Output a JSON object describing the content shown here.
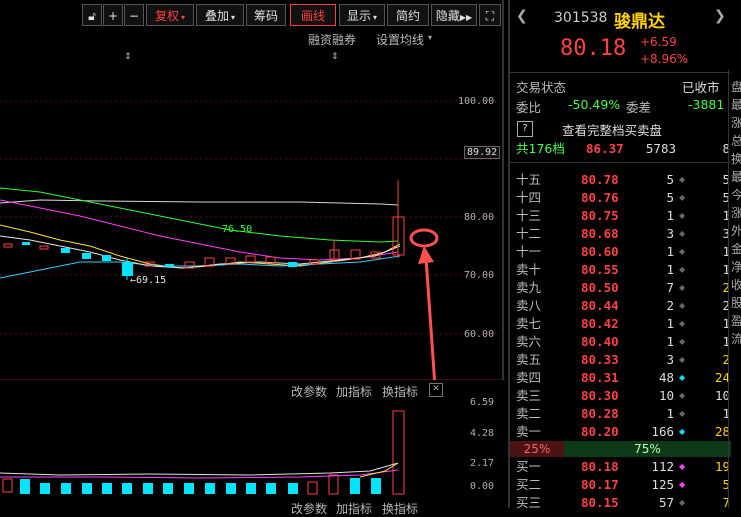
{
  "toolbar": {
    "buttons": [
      "复权",
      "叠加",
      "筹码",
      "画线",
      "显示",
      "简约",
      "隐藏"
    ]
  },
  "chart_top": {
    "links": [
      "融资融券",
      "设置均线"
    ],
    "y_ticks": [
      "100.00",
      "89.92",
      "80.00",
      "70.00",
      "60.00"
    ],
    "ma_label": "76.50",
    "low_label": "←69.15"
  },
  "indicator": {
    "links": [
      "改参数",
      "加指标",
      "换指标"
    ],
    "links_bottom": [
      "改参数",
      "加指标",
      "换指标"
    ],
    "y_ticks": [
      "6.59",
      "4.28",
      "2.17",
      "0.00"
    ]
  },
  "stock": {
    "code": "301538",
    "name": "骏鼎达",
    "price": "80.18",
    "change": "+6.59",
    "change_pct": "+8.96%"
  },
  "status": {
    "label": "交易状态",
    "value": "已收市",
    "ratio_label": "委比",
    "ratio_value": "-50.49%",
    "diff_label": "委差",
    "diff_value": "-3881",
    "full_book_label": "查看完整档买卖盘",
    "help": "?"
  },
  "total_row": {
    "label": "共176档",
    "price": "86.37",
    "vol": "5783",
    "cnt": "8"
  },
  "asks": [
    {
      "label": "十五",
      "price": "80.78",
      "vol": "5",
      "cnt": "5"
    },
    {
      "label": "十四",
      "price": "80.76",
      "vol": "5",
      "cnt": "5"
    },
    {
      "label": "十三",
      "price": "80.75",
      "vol": "1",
      "cnt": "1"
    },
    {
      "label": "十二",
      "price": "80.68",
      "vol": "3",
      "cnt": "3"
    },
    {
      "label": "十一",
      "price": "80.60",
      "vol": "1",
      "cnt": "1"
    },
    {
      "label": "卖十",
      "price": "80.55",
      "vol": "1",
      "cnt": "1"
    },
    {
      "label": "卖九",
      "price": "80.50",
      "vol": "7",
      "cnt": "2"
    },
    {
      "label": "卖八",
      "price": "80.44",
      "vol": "2",
      "cnt": "2"
    },
    {
      "label": "卖七",
      "price": "80.42",
      "vol": "1",
      "cnt": "1"
    },
    {
      "label": "卖六",
      "price": "80.40",
      "vol": "1",
      "cnt": "1"
    },
    {
      "label": "卖五",
      "price": "80.33",
      "vol": "3",
      "cnt": "2"
    },
    {
      "label": "卖四",
      "price": "80.31",
      "vol": "48",
      "cnt": "24"
    },
    {
      "label": "卖三",
      "price": "80.30",
      "vol": "10",
      "cnt": "10"
    },
    {
      "label": "卖二",
      "price": "80.28",
      "vol": "1",
      "cnt": "1"
    },
    {
      "label": "卖一",
      "price": "80.20",
      "vol": "166",
      "cnt": "28"
    }
  ],
  "split": {
    "sell_pct": "25%",
    "buy_pct": "75%"
  },
  "bids": [
    {
      "label": "买一",
      "price": "80.18",
      "vol": "112",
      "cnt": "19"
    },
    {
      "label": "买二",
      "price": "80.17",
      "vol": "125",
      "cnt": "5"
    },
    {
      "label": "买三",
      "price": "80.15",
      "vol": "57",
      "cnt": "7"
    }
  ],
  "edge_chars": [
    "盘",
    "最",
    "涨",
    "总",
    "换",
    "最",
    "今",
    "涨",
    "外",
    "金",
    "净",
    "收",
    "股",
    "盈",
    "流"
  ],
  "colors": {
    "up": "#ff4040",
    "down": "#00e5ff",
    "accent": "#ffd000",
    "green": "#40ff40"
  }
}
